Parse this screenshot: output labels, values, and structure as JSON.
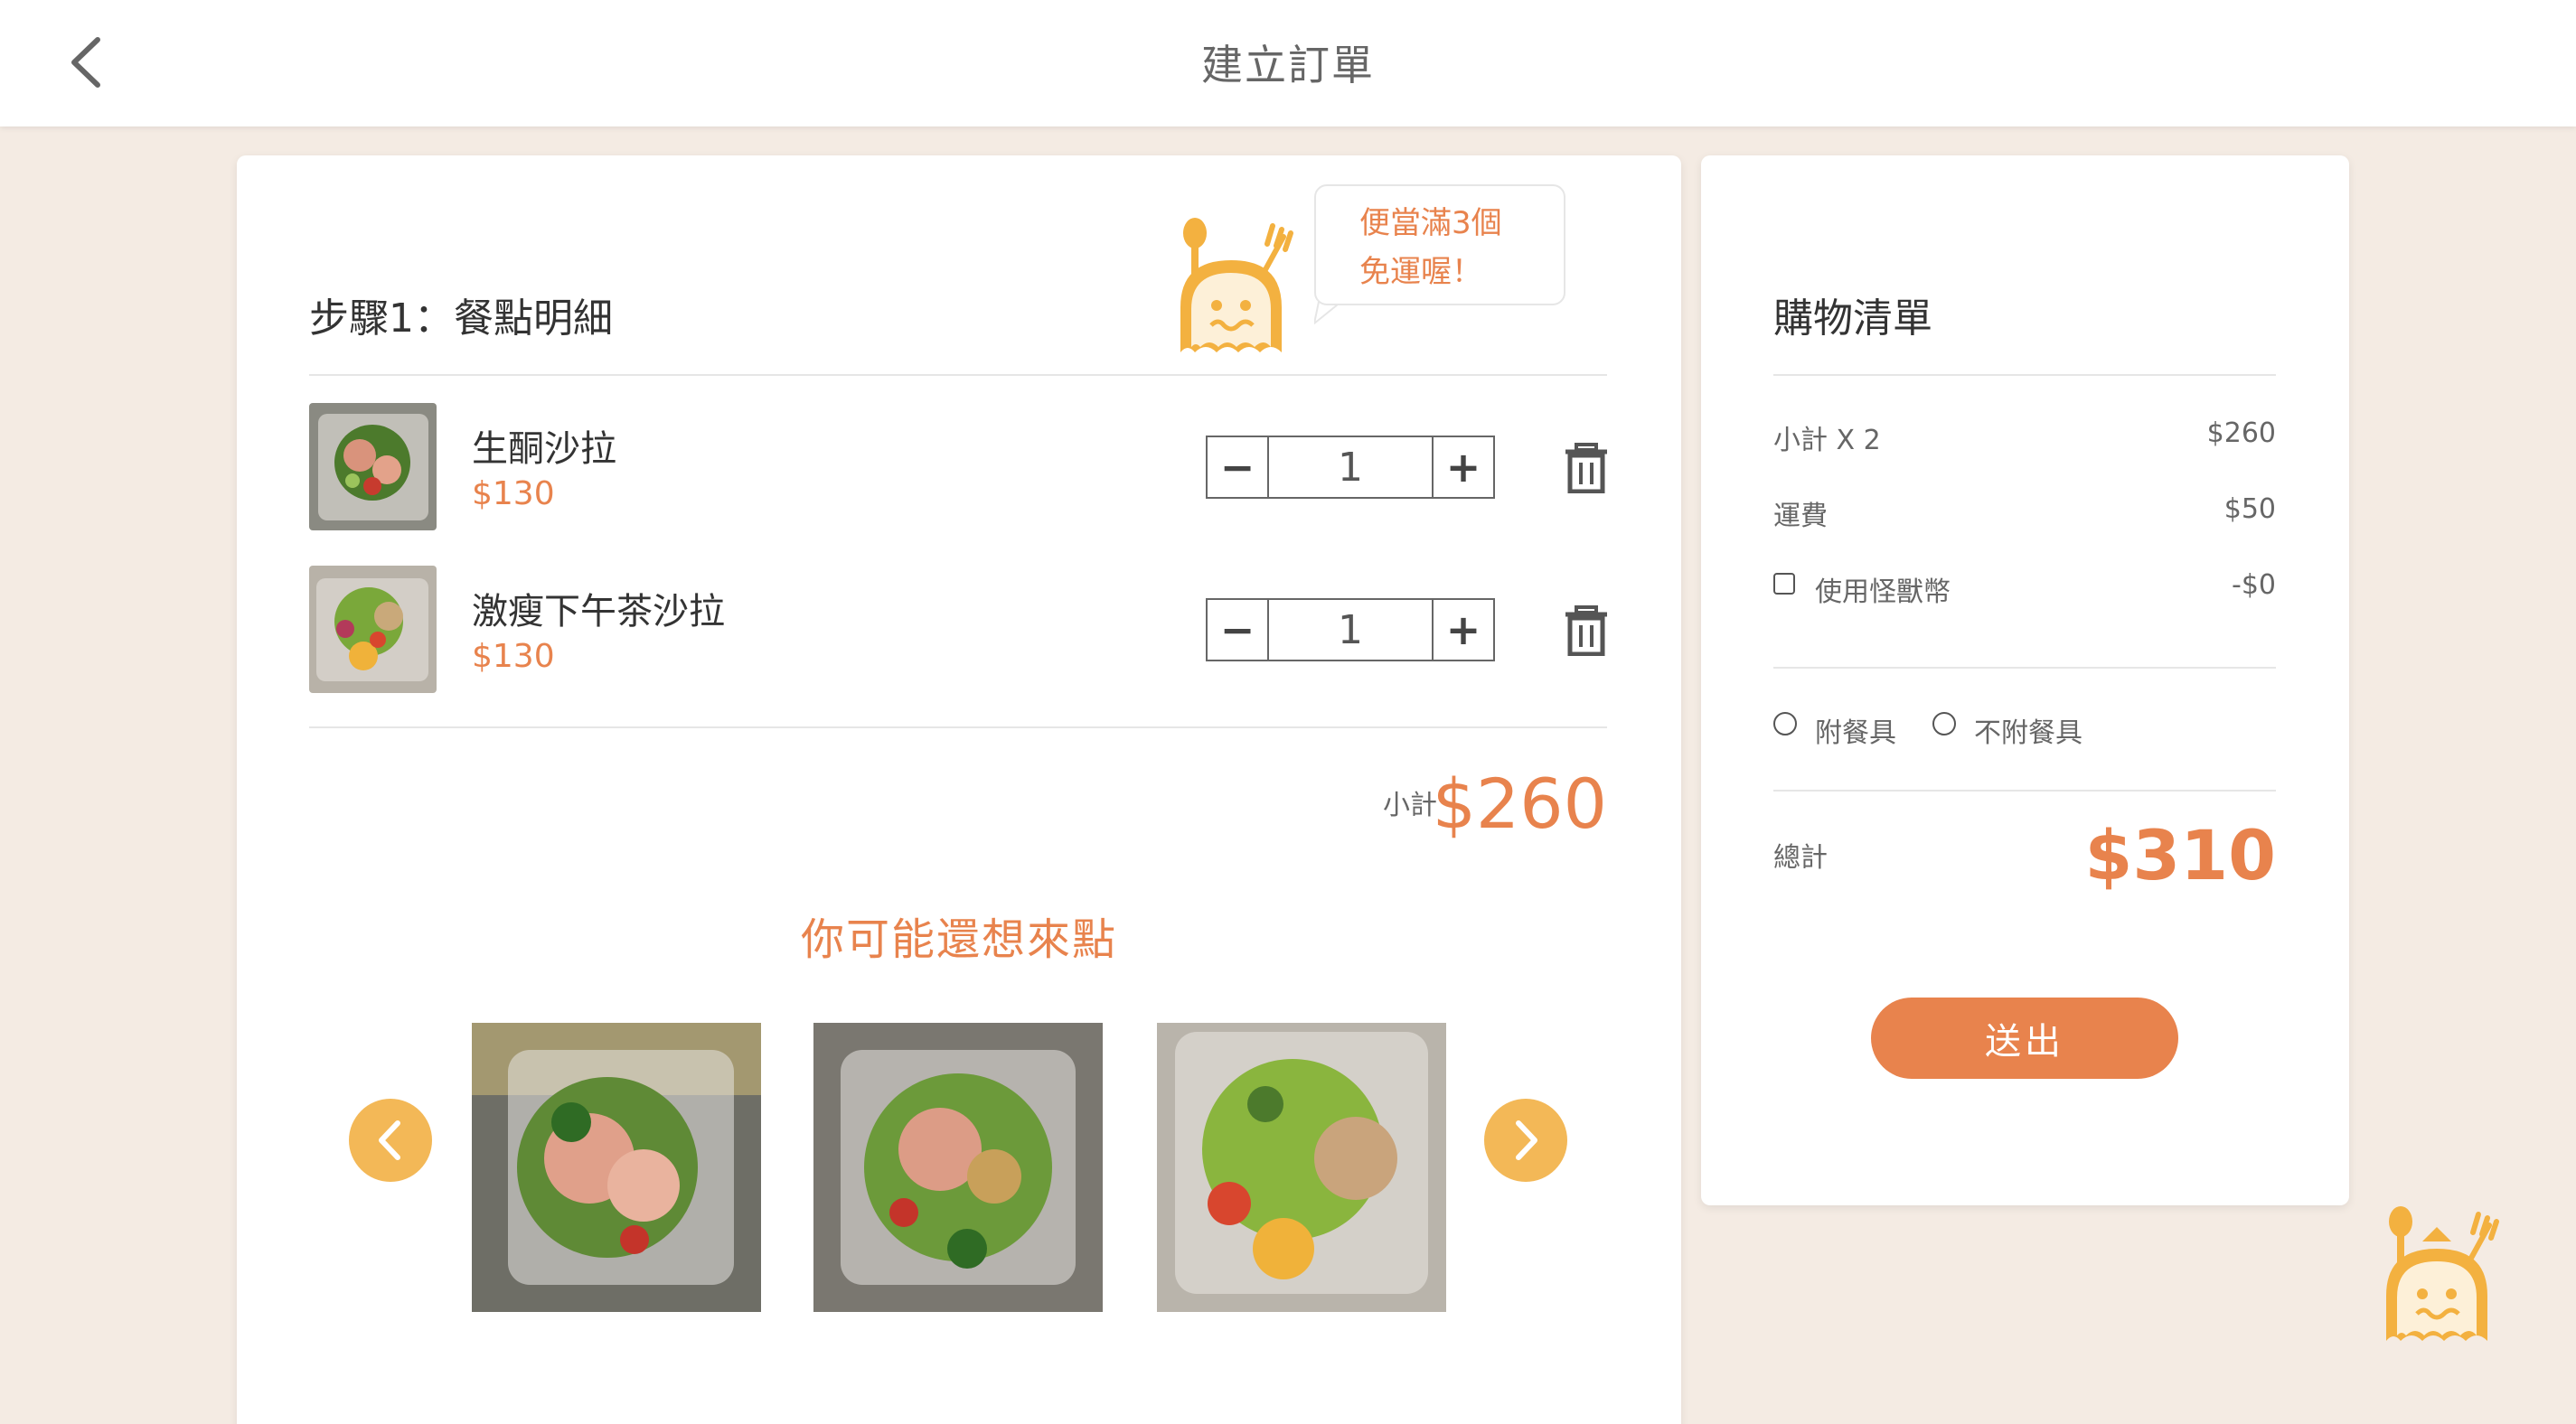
{
  "header": {
    "title": "建立訂單",
    "back_icon": "chevron-left-icon"
  },
  "colors": {
    "accent": "#e8834d",
    "arrow": "#f3b857",
    "background": "#f4ebe3"
  },
  "promo": {
    "line1": "便當滿3個",
    "line2": "免運喔！"
  },
  "step": {
    "title": "步驟1：餐點明細"
  },
  "cart_items": [
    {
      "name": "生酮沙拉",
      "price": "$130",
      "quantity": "1",
      "minus": "−",
      "plus": "+"
    },
    {
      "name": "激瘦下午茶沙拉",
      "price": "$130",
      "quantity": "1",
      "minus": "−",
      "plus": "+"
    }
  ],
  "subtotal": {
    "label": "小計",
    "value": "$260"
  },
  "suggestions": {
    "title": "你可能還想來點",
    "prev_icon": "chevron-left-icon",
    "next_icon": "chevron-right-icon"
  },
  "summary": {
    "title": "購物清單",
    "rows": [
      {
        "label": "小計 X 2",
        "value": "$260"
      },
      {
        "label": "運費",
        "value": "$50"
      },
      {
        "label": "使用怪獸幣",
        "value": "-$0"
      }
    ],
    "utensil_options": [
      "附餐具",
      "不附餐具"
    ],
    "total_label": "總計",
    "total_value": "$310",
    "submit_label": "送出"
  }
}
